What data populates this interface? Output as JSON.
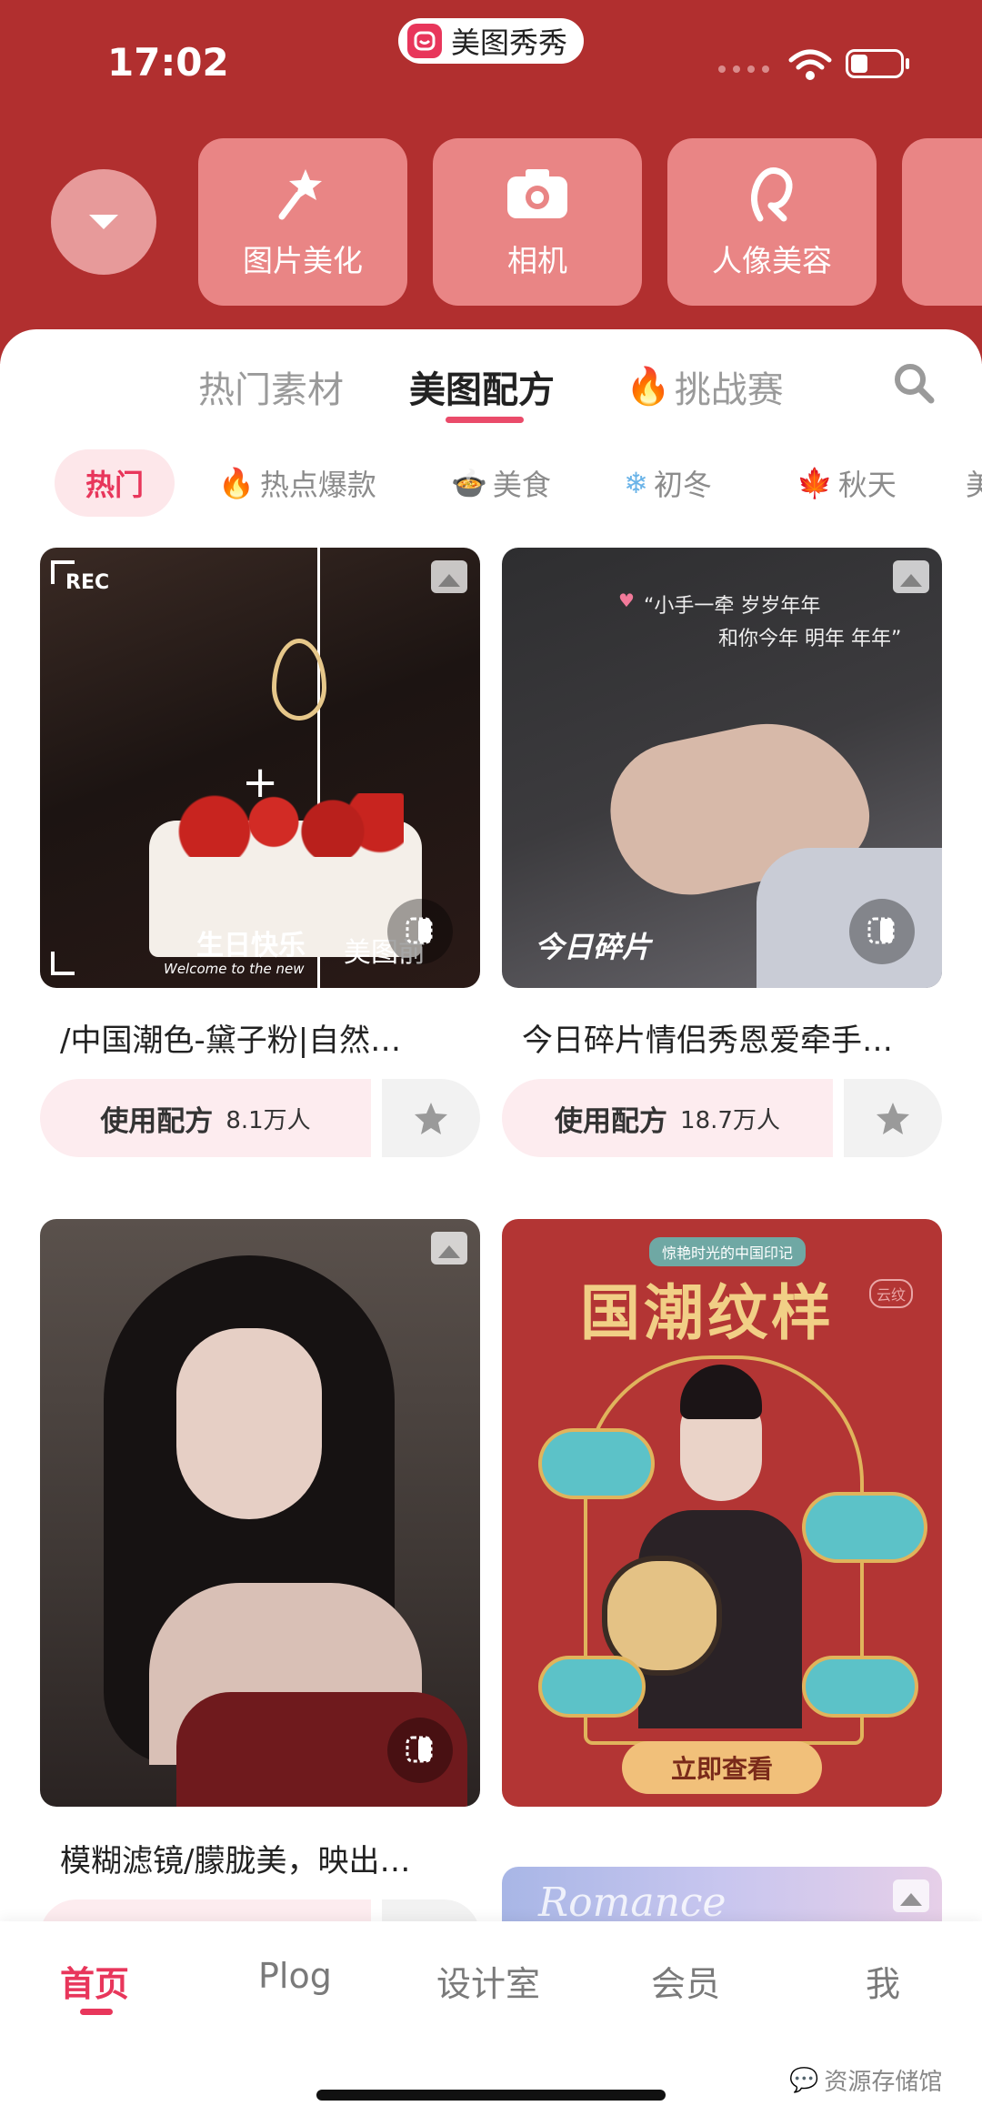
{
  "status": {
    "time": "17:02",
    "app_name": "美图秀秀",
    "battery_level": 0.35
  },
  "quick_actions": [
    {
      "label": "图片美化",
      "icon": "magic-wand-icon"
    },
    {
      "label": "相机",
      "icon": "camera-icon"
    },
    {
      "label": "人像美容",
      "icon": "portrait-icon"
    },
    {
      "label": "",
      "icon": "more-icon"
    }
  ],
  "tabs": [
    {
      "label": "热门素材"
    },
    {
      "label": "美图配方",
      "active": true
    },
    {
      "label": "挑战赛",
      "icon": "fire-icon"
    }
  ],
  "chips": [
    {
      "label": "热门",
      "active": true
    },
    {
      "label": "热点爆款",
      "icon": "fire-icon"
    },
    {
      "label": "美食",
      "icon": "bowl-icon"
    },
    {
      "label": "初冬",
      "icon": "snowflake-icon"
    },
    {
      "label": "秋天",
      "icon": "maple-leaf-icon"
    },
    {
      "label": "美"
    }
  ],
  "cards": [
    {
      "title": "/中国潮色-黛子粉|自然…",
      "use_label": "使用配方",
      "count": "8.1万人",
      "overlay": {
        "rec": "REC",
        "caption": "生日快乐",
        "sub": "Welcome to the new",
        "before": "美图前"
      }
    },
    {
      "title": "今日碎片情侣秀恩爱牵手…",
      "use_label": "使用配方",
      "count": "18.7万人",
      "overlay": {
        "quote1": "“小手一牵 岁岁年年",
        "quote2": "和你今年 明年 年年”",
        "caption": "今日碎片"
      }
    },
    {
      "title": "模糊滤镜/朦胧美，映出…"
    },
    {
      "ad": {
        "top": "惊艳时光的中国印记",
        "headline": "国潮纹样",
        "side": "云纹",
        "button": "立即查看"
      }
    },
    {
      "partial": "Romance"
    }
  ],
  "bottom_nav": [
    {
      "label": "首页",
      "active": true
    },
    {
      "label": "Plog"
    },
    {
      "label": "设计室"
    },
    {
      "label": "会员"
    },
    {
      "label": "我"
    }
  ],
  "watermark": "资源存储馆",
  "colors": {
    "brand_red": "#b12f2f",
    "accent_pink": "#e8365b"
  }
}
